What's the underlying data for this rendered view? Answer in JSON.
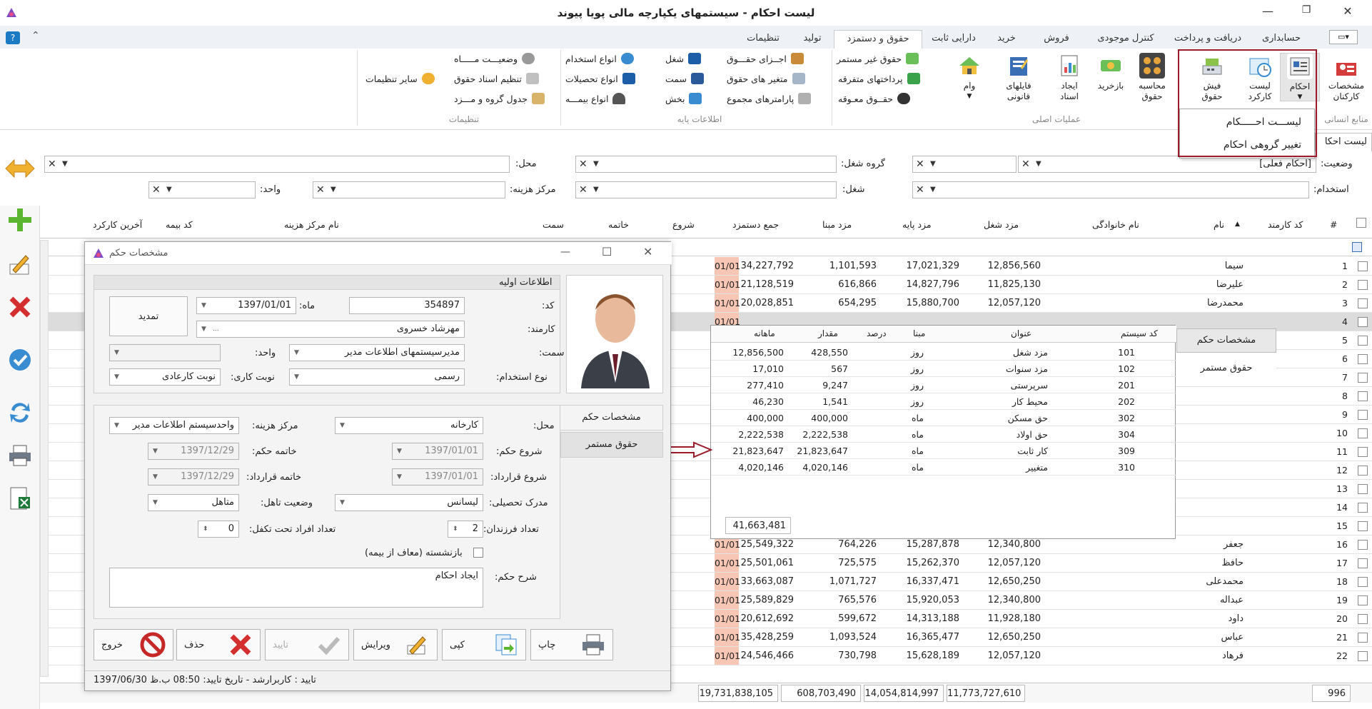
{
  "window": {
    "title": "لیست احکام - سیستمهای یکپارچه مالی پویا پیوند"
  },
  "tabs": [
    "حسابداری",
    "دریافت و پرداخت",
    "کنترل موجودی",
    "فروش",
    "خرید",
    "دارایی ثابت",
    "حقوق و دستمزد",
    "تولید",
    "تنظیمات"
  ],
  "ribbon": {
    "groups": {
      "hr": "منابع انسانی",
      "main_ops": "عملیات اصلی",
      "base_info": "اطلاعات پایه",
      "settings": "تنظیمات"
    },
    "buttons": {
      "employee_specs": "مشخصات کارکنان",
      "ahkam": "احکام",
      "work_list": "لیست کارکرد",
      "payslip": "فیش حقوق",
      "calc_salary": "محاسبه حقوق",
      "buyback": "بازخرید",
      "create_docs": "ایجاد اسناد",
      "legal_files": "فایلهای قانونی",
      "loan": "وام"
    },
    "items": {
      "non_continuous": "حقوق غیر مستمر",
      "misc_payments": "پرداختهای متفرقه",
      "deferred_salary": "حقــوق معـوقه",
      "salary_components": "اجــزای حقـــوق",
      "salary_variables": "متغیر های حقوق",
      "total_params": "پارامترهای مجموع",
      "job": "شغل",
      "position": "سمت",
      "section": "بخش",
      "employment_types": "انواع استخدام",
      "education_types": "انواع تحصیلات",
      "insurance_types": "انواع بیمـــه",
      "status": "وضعیـــت مـــــاه",
      "salary_doc_settings": "تنظیم اسناد حقوق",
      "group_wage_table": "جدول گروه و مـــزد",
      "other_settings": "سایر تنظیمات"
    }
  },
  "dropdown": [
    "لیســـت احـــــکام",
    "تغییر گروهی احکام"
  ],
  "doc_tab": "لیست احکا",
  "filters": {
    "status_label": "وضعیت:",
    "status_value": "[احکام فعلی]",
    "job_group_label": "گروه شغل:",
    "place_label": "محل:",
    "employment_label": "استخدام:",
    "job_label": "شغل:",
    "cost_center_label": "مرکز هزینه:",
    "unit_label": "واحد:"
  },
  "grid": {
    "headers": {
      "num": "#",
      "emp_code": "کد کارمند",
      "first_name": "نام",
      "last_name": "نام خانوادگی",
      "job_wage": "مزد شغل",
      "base_wage": "مزد پایه",
      "mabna": "مزد مبنا",
      "total": "جمع دستمزد",
      "start": "شروع",
      "end": "خاتمه",
      "position": "سمت",
      "cost_center": "نام مرکز هزینه",
      "insurance": "کد بیمه",
      "last_work": "آخرین کارکرد"
    },
    "rows": [
      {
        "n": "1",
        "name": "سیما",
        "job": "12,856,560",
        "base": "17,021,329",
        "mabna": "1,101,593",
        "total": "34,227,792"
      },
      {
        "n": "2",
        "name": "علیرضا",
        "job": "11,825,130",
        "base": "14,827,796",
        "mabna": "616,866",
        "total": "21,128,519"
      },
      {
        "n": "3",
        "name": "محمدرضا",
        "job": "12,057,120",
        "base": "15,880,700",
        "mabna": "654,295",
        "total": "20,028,851"
      },
      {
        "n": "4"
      },
      {
        "n": "5"
      },
      {
        "n": "6"
      },
      {
        "n": "7"
      },
      {
        "n": "8"
      },
      {
        "n": "9"
      },
      {
        "n": "10"
      },
      {
        "n": "11"
      },
      {
        "n": "12"
      },
      {
        "n": "13"
      },
      {
        "n": "14"
      },
      {
        "n": "15"
      },
      {
        "n": "16",
        "name": "جعفر",
        "job": "12,340,800",
        "base": "15,287,878",
        "mabna": "764,226",
        "total": "25,549,322"
      },
      {
        "n": "17",
        "name": "حافظ",
        "job": "12,057,120",
        "base": "15,262,370",
        "mabna": "725,575",
        "total": "25,501,061"
      },
      {
        "n": "18",
        "name": "محمدعلی",
        "job": "12,650,250",
        "base": "16,337,471",
        "mabna": "1,071,727",
        "total": "33,663,087"
      },
      {
        "n": "19",
        "name": "عبداله",
        "job": "12,340,800",
        "base": "15,920,053",
        "mabna": "765,576",
        "total": "25,589,829"
      },
      {
        "n": "20",
        "name": "داود",
        "job": "11,928,180",
        "base": "14,313,188",
        "mabna": "599,672",
        "total": "20,612,692"
      },
      {
        "n": "21",
        "name": "عباس",
        "job": "12,650,250",
        "base": "16,365,477",
        "mabna": "1,093,524",
        "total": "35,428,259"
      },
      {
        "n": "22",
        "name": "فرهاد",
        "job": "12,057,120",
        "base": "15,628,189",
        "mabna": "730,798",
        "total": "24,546,466"
      }
    ],
    "start_prefix": "01/01",
    "footer": {
      "count": "996",
      "job": "11,773,727,610",
      "base": "14,054,814,997",
      "mabna": "608,703,490",
      "total": "19,731,838,105"
    }
  },
  "side_tabs": {
    "specs": "مشخصات حکم",
    "continuous": "حقوق مستمر"
  },
  "popup": {
    "headers": {
      "code": "کد سیستم",
      "title": "عنوان",
      "mabna": "مبنا",
      "percent": "درصد",
      "amount": "مقدار",
      "monthly": "ماهانه"
    },
    "rows": [
      {
        "code": "101",
        "title": "مزد شغل",
        "mabna": "روز",
        "amount": "428,550",
        "monthly": "12,856,500"
      },
      {
        "code": "102",
        "title": "مزد سنوات",
        "mabna": "روز",
        "amount": "567",
        "monthly": "17,010"
      },
      {
        "code": "201",
        "title": "سرپرستی",
        "mabna": "روز",
        "amount": "9,247",
        "monthly": "277,410"
      },
      {
        "code": "202",
        "title": "محیط کار",
        "mabna": "روز",
        "amount": "1,541",
        "monthly": "46,230"
      },
      {
        "code": "302",
        "title": "حق مسکن",
        "mabna": "ماه",
        "amount": "400,000",
        "monthly": "400,000"
      },
      {
        "code": "304",
        "title": "حق اولاد",
        "mabna": "ماه",
        "amount": "2,222,538",
        "monthly": "2,222,538"
      },
      {
        "code": "309",
        "title": "کار ثابت",
        "mabna": "ماه",
        "amount": "21,823,647",
        "monthly": "21,823,647"
      },
      {
        "code": "310",
        "title": "متغییر",
        "mabna": "ماه",
        "amount": "4,020,146",
        "monthly": "4,020,146"
      }
    ],
    "total": "41,663,481"
  },
  "dialog": {
    "title": "مشخصات حکم",
    "section_title": "اطلاعات اولیه",
    "code_label": "کد:",
    "code_value": "354897",
    "month_label": "ماه:",
    "month_value": "1397/01/01",
    "extend_button": "تمدید",
    "employee_label": "کارمند:",
    "employee_value": "مهرشاد خسروی",
    "employee_more": "...",
    "position_label": "سمت:",
    "position_value": "مدیرسیستمهای اطلاعات مدیر",
    "unit_label": "واحد:",
    "employment_label": "نوع استخدام:",
    "employment_value": "رسمی",
    "shift_label": "نوبت کاری:",
    "shift_value": "نوبت کارعادی",
    "place_label": "محل:",
    "place_value": "کارخانه",
    "cost_center_label": "مرکز هزینه:",
    "cost_center_value": "واحدسیستم اطلاعات مدیر",
    "decree_start_label": "شروع حکم:",
    "decree_start_value": "1397/01/01",
    "decree_end_label": "خاتمه حکم:",
    "decree_end_value": "1397/12/29",
    "contract_start_label": "شروع قرارداد:",
    "contract_start_value": "1397/01/01",
    "contract_end_label": "خاتمه قرارداد:",
    "contract_end_value": "1397/12/29",
    "education_label": "مدرک تحصیلی:",
    "education_value": "لیسانس",
    "marital_label": "وضعیت تاهل:",
    "marital_value": "متاهل",
    "children_label": "تعداد فرزندان:",
    "children_value": "2",
    "dependents_label": "تعداد افراد تحت تکفل:",
    "dependents_value": "0",
    "retired_label": "بازنشسته (معاف از بیمه)",
    "desc_label": "شرح حکم:",
    "desc_value": "ایجاد احکام",
    "buttons": {
      "print": "چاپ",
      "copy": "کپی",
      "edit": "ویرایش",
      "confirm": "تایید",
      "delete": "حذف",
      "exit": "خروج"
    },
    "status": "تایید : کاربرارشد - تاریخ تایید: 08:50 ب.ظ 1397/06/30"
  }
}
